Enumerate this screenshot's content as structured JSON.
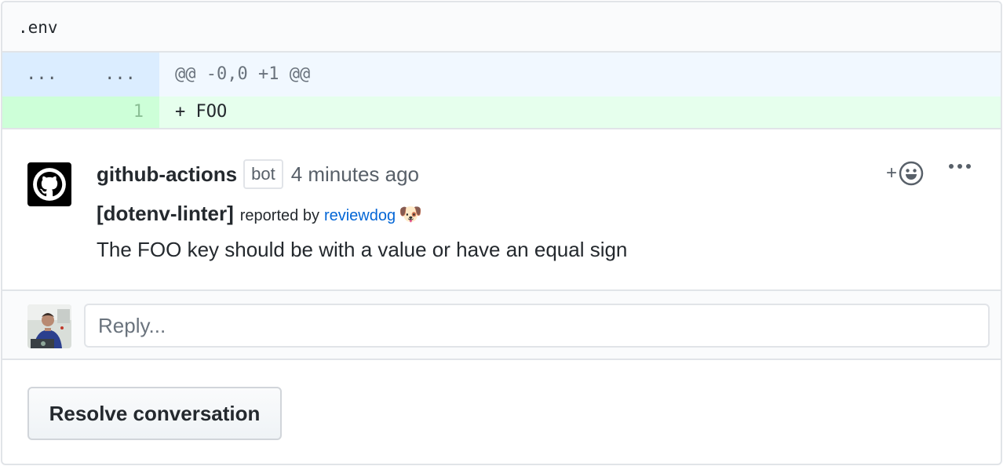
{
  "file": {
    "name": ".env"
  },
  "diff": {
    "hunk": {
      "left_num": "...",
      "right_num": "...",
      "header": "@@ -0,0 +1 @@"
    },
    "added_line": {
      "number": "1",
      "text": "+ FOO"
    }
  },
  "comment": {
    "author": "github-actions",
    "badge": "bot",
    "time": "4 minutes ago",
    "linter": "[dotenv-linter]",
    "reported_by": "reported by",
    "reporter": "reviewdog",
    "emoji": "🐶",
    "message": "The FOO key should be with a value or have an equal sign",
    "reaction_plus": "+"
  },
  "reply": {
    "placeholder": "Reply..."
  },
  "actions": {
    "resolve_label": "Resolve conversation"
  },
  "colors": {
    "accent": "#0366d6",
    "addition_bg": "#e6ffed",
    "hunk_bg": "#f1f8ff"
  }
}
